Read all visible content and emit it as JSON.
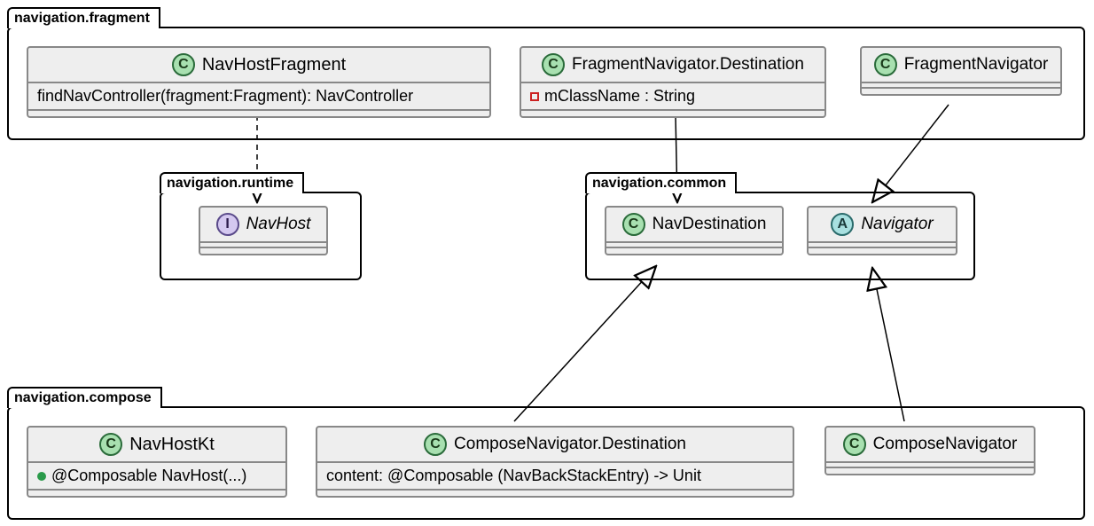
{
  "packages": {
    "fragment": {
      "label": "navigation.fragment"
    },
    "runtime": {
      "label": "navigation.runtime"
    },
    "common": {
      "label": "navigation.common"
    },
    "compose": {
      "label": "navigation.compose"
    }
  },
  "classes": {
    "navHostFragment": {
      "badge": "C",
      "name": "NavHostFragment",
      "method": "findNavController(fragment:Fragment): NavController"
    },
    "fragNavDest": {
      "badge": "C",
      "name": "FragmentNavigator.Destination",
      "field": "mClassName : String"
    },
    "fragNav": {
      "badge": "C",
      "name": "FragmentNavigator"
    },
    "navHost": {
      "badge": "I",
      "name": "NavHost"
    },
    "navDest": {
      "badge": "C",
      "name": "NavDestination"
    },
    "navigator": {
      "badge": "A",
      "name": "Navigator"
    },
    "navHostKt": {
      "badge": "C",
      "name": "NavHostKt",
      "method": "@Composable NavHost(...)"
    },
    "composeNavDest": {
      "badge": "C",
      "name": "ComposeNavigator.Destination",
      "field": "content: @Composable (NavBackStackEntry) -> Unit"
    },
    "composeNav": {
      "badge": "C",
      "name": "ComposeNavigator"
    }
  }
}
